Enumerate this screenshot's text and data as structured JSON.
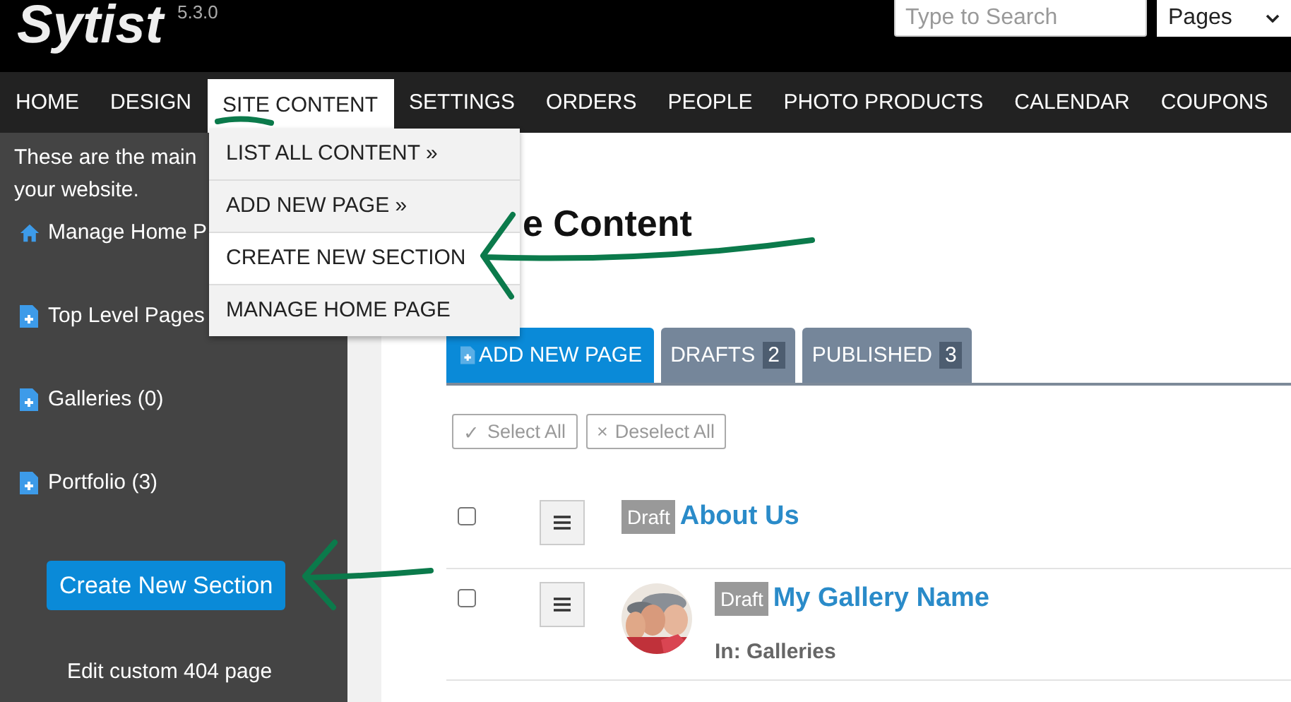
{
  "app": {
    "logo": "Sytist",
    "version": "5.3.0"
  },
  "search": {
    "placeholder": "Type to Search"
  },
  "search_scope": {
    "value": "Pages"
  },
  "nav": [
    {
      "label": "HOME",
      "selected": false
    },
    {
      "label": "DESIGN",
      "selected": false
    },
    {
      "label": "SITE CONTENT",
      "selected": true
    },
    {
      "label": "SETTINGS",
      "selected": false
    },
    {
      "label": "ORDERS",
      "selected": false
    },
    {
      "label": "PEOPLE",
      "selected": false
    },
    {
      "label": "PHOTO PRODUCTS",
      "selected": false
    },
    {
      "label": "CALENDAR",
      "selected": false
    },
    {
      "label": "COUPONS",
      "selected": false
    }
  ],
  "dropdown": [
    {
      "label": "LIST ALL CONTENT »",
      "selected": false
    },
    {
      "label": "ADD NEW PAGE »",
      "selected": false
    },
    {
      "label": "CREATE NEW SECTION",
      "selected": true
    },
    {
      "label": "MANAGE HOME PAGE",
      "selected": false
    }
  ],
  "sidebar": {
    "intro": [
      "These are the main",
      "your website."
    ],
    "items": [
      {
        "kind": "home",
        "label": "Manage Home P"
      },
      {
        "kind": "page",
        "label": "Top Level Pages"
      },
      {
        "kind": "page",
        "label": "Galleries (0)"
      },
      {
        "kind": "page",
        "label": "Portfolio (3)"
      }
    ],
    "button": "Create New Section",
    "link": "Edit custom 404 page"
  },
  "page": {
    "title": "e Content",
    "tabs": [
      {
        "kind": "add",
        "label": "ADD NEW PAGE"
      },
      {
        "kind": "tab",
        "label": "DRAFTS",
        "count": "2"
      },
      {
        "kind": "tab",
        "label": "PUBLISHED",
        "count": "3"
      }
    ],
    "bulk_actions": [
      {
        "icon": "✓",
        "label": "Select All"
      },
      {
        "icon": "×",
        "label": "Deselect All"
      }
    ],
    "rows": [
      {
        "checked": false,
        "status": "Draft",
        "title": "About Us"
      },
      {
        "checked": false,
        "status": "Draft",
        "title": "My Gallery Name",
        "section": "In: Galleries"
      }
    ]
  }
}
